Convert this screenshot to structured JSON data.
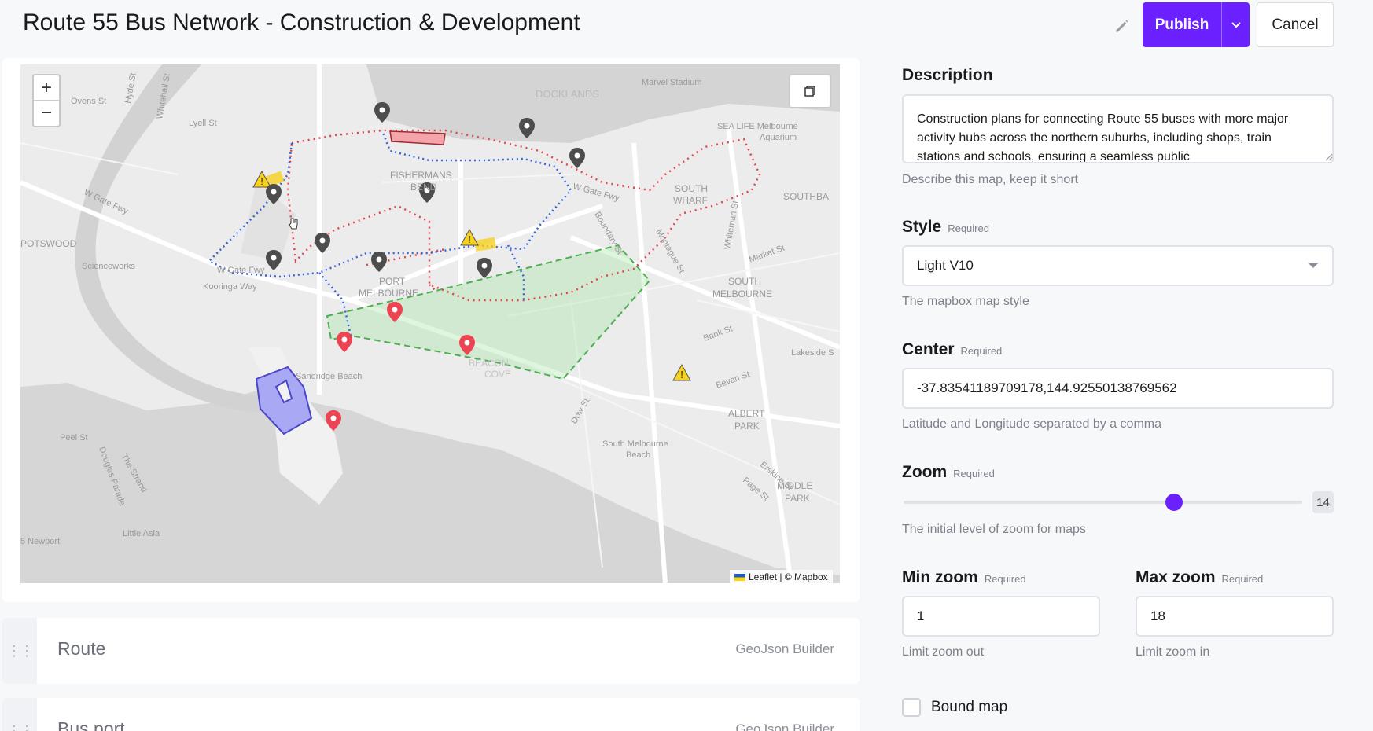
{
  "header": {
    "title": "Route 55 Bus Network - Construction & Development",
    "publish_label": "Publish",
    "cancel_label": "Cancel"
  },
  "map": {
    "zoom_in": "+",
    "zoom_out": "−",
    "attribution": "Leaflet | © Mapbox",
    "labels": [
      {
        "text": "DOCKLANDS"
      },
      {
        "text": "Marvel Stadium"
      },
      {
        "text": "SEA LIFE Melbourne"
      },
      {
        "text": "Aquarium"
      },
      {
        "text": "FISHERMANS"
      },
      {
        "text": "BEND"
      },
      {
        "text": "SOUTH"
      },
      {
        "text": "WHARF"
      },
      {
        "text": "SOUTHBA"
      },
      {
        "text": "POTSWOOD"
      },
      {
        "text": "Scienceworks"
      },
      {
        "text": "PORT"
      },
      {
        "text": "MELBOURNE"
      },
      {
        "text": "SOUTH"
      },
      {
        "text": "MELBOURNE"
      },
      {
        "text": "Lakeside S"
      },
      {
        "text": "ALBERT"
      },
      {
        "text": "PARK"
      },
      {
        "text": "MIDDLE"
      },
      {
        "text": "PARK"
      },
      {
        "text": "South Melbourne"
      },
      {
        "text": "Beach"
      },
      {
        "text": "BEACON"
      },
      {
        "text": "COVE"
      },
      {
        "text": "Sandridge Beach"
      },
      {
        "text": "Little Asia"
      },
      {
        "text": "5 Newport"
      },
      {
        "text": "Peel St"
      },
      {
        "text": "W Gate Fwy"
      },
      {
        "text": "W Gate Fwy"
      },
      {
        "text": "W Gate Fwy"
      },
      {
        "text": "Kooringa Way"
      },
      {
        "text": "Douglas Parade"
      },
      {
        "text": "The Strand"
      },
      {
        "text": "Ovens St"
      },
      {
        "text": "Hyde St"
      },
      {
        "text": "Whitehall St"
      },
      {
        "text": "Lyell St"
      },
      {
        "text": "Whiteman St"
      },
      {
        "text": "Market St"
      },
      {
        "text": "Bank St"
      },
      {
        "text": "Bevan St"
      },
      {
        "text": "Dow St"
      },
      {
        "text": "Page St"
      },
      {
        "text": "Erskine St"
      },
      {
        "text": "Boundary St"
      },
      {
        "text": "Montague St"
      }
    ]
  },
  "layers": [
    {
      "label": "Route",
      "kind": "GeoJson Builder"
    },
    {
      "label": "Bus port",
      "kind": "GeoJson Builder"
    }
  ],
  "form": {
    "description": {
      "label": "Description",
      "value": "Construction plans for connecting Route 55 buses with more major activity hubs across the northern suburbs, including shops, train stations and schools, ensuring a seamless public",
      "help": "Describe this map, keep it short"
    },
    "style": {
      "label": "Style",
      "required": "Required",
      "value": "Light V10",
      "help": "The mapbox map style"
    },
    "center": {
      "label": "Center",
      "required": "Required",
      "value": "-37.83541189709178,144.92550138769562",
      "help": "Latitude and Longitude separated by a comma"
    },
    "zoom": {
      "label": "Zoom",
      "required": "Required",
      "value": "14",
      "fraction": 0.678,
      "help": "The initial level of zoom for maps"
    },
    "min_zoom": {
      "label": "Min zoom",
      "required": "Required",
      "value": "1",
      "help": "Limit zoom out"
    },
    "max_zoom": {
      "label": "Max zoom",
      "required": "Required",
      "value": "18",
      "help": "Limit zoom in"
    },
    "bound_map": {
      "label": "Bound map"
    }
  },
  "colors": {
    "accent": "#6b21ff",
    "route_red": "#e0454f",
    "route_blue": "#3a63d6",
    "zone_green": "#4caf50",
    "port_fill": "#a9a8f5",
    "port_stroke": "#4b46c8",
    "pin_grey": "#4d4d4d",
    "pin_red": "#ec4452",
    "warning": "#f6d21f"
  }
}
